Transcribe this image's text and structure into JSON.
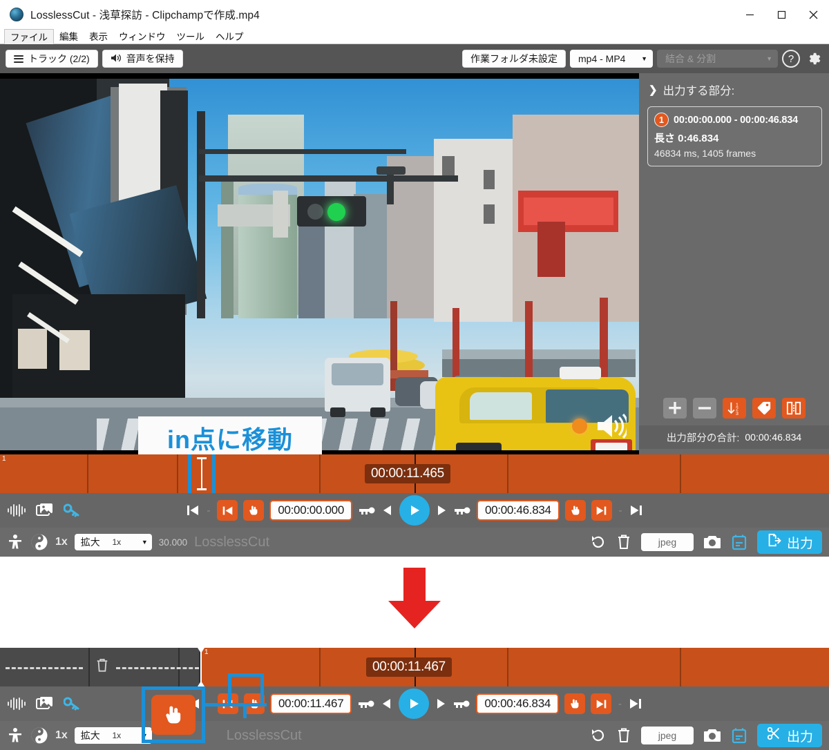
{
  "window": {
    "title": "LosslessCut - 浅草探訪 - Clipchampで作成.mp4",
    "minimize_label": "–",
    "maximize_label": "□",
    "close_label": "✕"
  },
  "menubar": {
    "items": [
      {
        "label": "ファイル",
        "active": true
      },
      {
        "label": "編集",
        "active": false
      },
      {
        "label": "表示",
        "active": false
      },
      {
        "label": "ウィンドウ",
        "active": false
      },
      {
        "label": "ツール",
        "active": false
      },
      {
        "label": "ヘルプ",
        "active": false
      }
    ]
  },
  "toolbar": {
    "tracks_label": "トラック (2/2)",
    "keep_audio_label": "音声を保持",
    "working_folder_label": "作業フォルダ未設定",
    "format_label": "mp4 - MP4",
    "merge_split_label": "結合 & 分割",
    "help_label": "?",
    "settings_label": "設定"
  },
  "right_panel": {
    "header": "出力する部分:",
    "segments": [
      {
        "index": "1",
        "range": "00:00:00.000 - 00:00:46.834",
        "length_label": "長さ 0:46.834",
        "detail": "46834 ms, 1405 frames"
      }
    ],
    "actions": [
      {
        "name": "add-segment",
        "glyph": "+",
        "style": "grey"
      },
      {
        "name": "remove-segment",
        "glyph": "–",
        "style": "grey"
      },
      {
        "name": "sort-segments",
        "glyph": "sort",
        "style": "orange"
      },
      {
        "name": "label-segment",
        "glyph": "tag",
        "style": "orange"
      },
      {
        "name": "split-segment",
        "glyph": "split",
        "style": "orange"
      }
    ],
    "total_label": "出力部分の合計:",
    "total_value": "00:00:46.834"
  },
  "top_editor": {
    "timeline": {
      "current_time": "00:00:11.465",
      "segment_index": "1"
    },
    "controls": {
      "waveform_icon": "waveform-icon",
      "thumbnails_icon": "thumbnails-icon",
      "keyframe_icon": "key-icon",
      "prev_keyframe_icon": "jump-start-icon",
      "dash": "-",
      "set_in_icon": "set-in-icon",
      "goto_in_icon": "goto-in-icon",
      "in_time": "00:00:00.000",
      "key_in_icon": "key-in-icon",
      "step_back_icon": "step-back-icon",
      "play_icon": "play-icon",
      "step_fwd_icon": "step-forward-icon",
      "key_out_icon": "key-out-icon",
      "out_time": "00:00:46.834",
      "goto_out_icon": "goto-out-icon",
      "set_out_icon": "set-out-icon",
      "dash2": "-",
      "jump_end_icon": "jump-end-icon"
    },
    "bottom": {
      "child_icon": "child-icon",
      "yinyang_icon": "yinyang-icon",
      "speed": "1x",
      "zoom_label": "拡大",
      "zoom_value": "1x",
      "fps": "30.000",
      "brand": "LosslessCut",
      "rotate_icon": "rotate-icon",
      "delete_icon": "trash-icon",
      "capture_format": "jpeg",
      "camera_icon": "camera-icon",
      "calendar_icon": "calendar-icon",
      "export_label": "出力",
      "export_icon": "export-icon"
    }
  },
  "bottom_editor": {
    "timeline": {
      "current_time": "00:00:11.467",
      "segment_index": "1",
      "cutout_icon": "trash-icon"
    },
    "controls": {
      "in_time": "00:00:11.467",
      "out_time": "00:00:46.834",
      "dash": "-",
      "dash2": "-"
    },
    "bottom": {
      "speed": "1x",
      "zoom_label": "拡大",
      "zoom_value": "1x",
      "brand": "LosslessCut",
      "capture_format": "jpeg",
      "export_label": "出力",
      "export_icon": "scissors-icon"
    }
  },
  "annotations": {
    "callout_text": "in点に移動",
    "accent_color": "#1b90d8",
    "arrow_color": "#e52421"
  },
  "colors": {
    "timeline_orange": "#c8501a",
    "accent_blue": "#27b0e6",
    "panel_grey": "#6a6a6a",
    "toolbar_grey": "#555555",
    "button_orange": "#e2581e"
  }
}
